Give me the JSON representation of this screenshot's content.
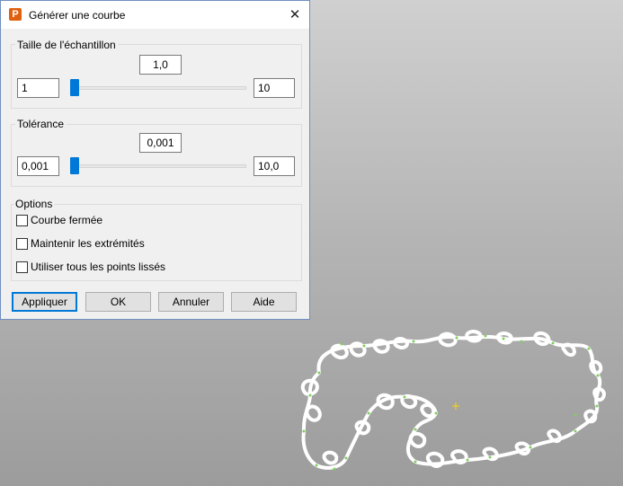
{
  "dialog": {
    "title": "Générer une courbe",
    "icon": "app-logo-icon",
    "close_glyph": "✕"
  },
  "sample_size": {
    "label": "Taille de l'échantillon",
    "current": "1,0",
    "min": "1",
    "max": "10",
    "slider_fraction": 0.0
  },
  "tolerance": {
    "label": "Tolérance",
    "current": "0,001",
    "min": "0,001",
    "max": "10,0",
    "slider_fraction": 0.0
  },
  "options": {
    "label": "Options",
    "items": [
      {
        "label": "Courbe fermée",
        "checked": false
      },
      {
        "label": "Maintenir les extrémités",
        "checked": false
      },
      {
        "label": "Utiliser tous les points lissés",
        "checked": false
      }
    ]
  },
  "buttons": {
    "apply": "Appliquer",
    "ok": "OK",
    "cancel": "Annuler",
    "help": "Aide"
  },
  "colors": {
    "accent": "#0078d7",
    "curve": "#ffffff",
    "points": "#7fd05f",
    "center_marker": "#ffd700"
  }
}
